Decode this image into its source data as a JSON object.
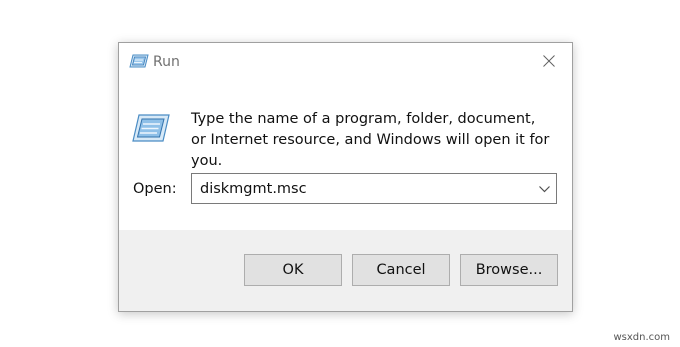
{
  "dialog": {
    "title": "Run",
    "description": "Type the name of a program, folder, document, or Internet resource, and Windows will open it for you.",
    "open_label": "Open:",
    "open_value": "diskmgmt.msc",
    "buttons": {
      "ok": "OK",
      "cancel": "Cancel",
      "browse": "Browse..."
    },
    "icons": {
      "title": "run-app-icon",
      "body": "run-app-icon",
      "close": "close-icon",
      "dropdown": "chevron-down-icon"
    }
  },
  "watermark": "wsxdn.com",
  "colors": {
    "footer_bg": "#f0f0f0",
    "button_bg": "#e1e1e1",
    "icon_blue": "#4a90c8"
  }
}
